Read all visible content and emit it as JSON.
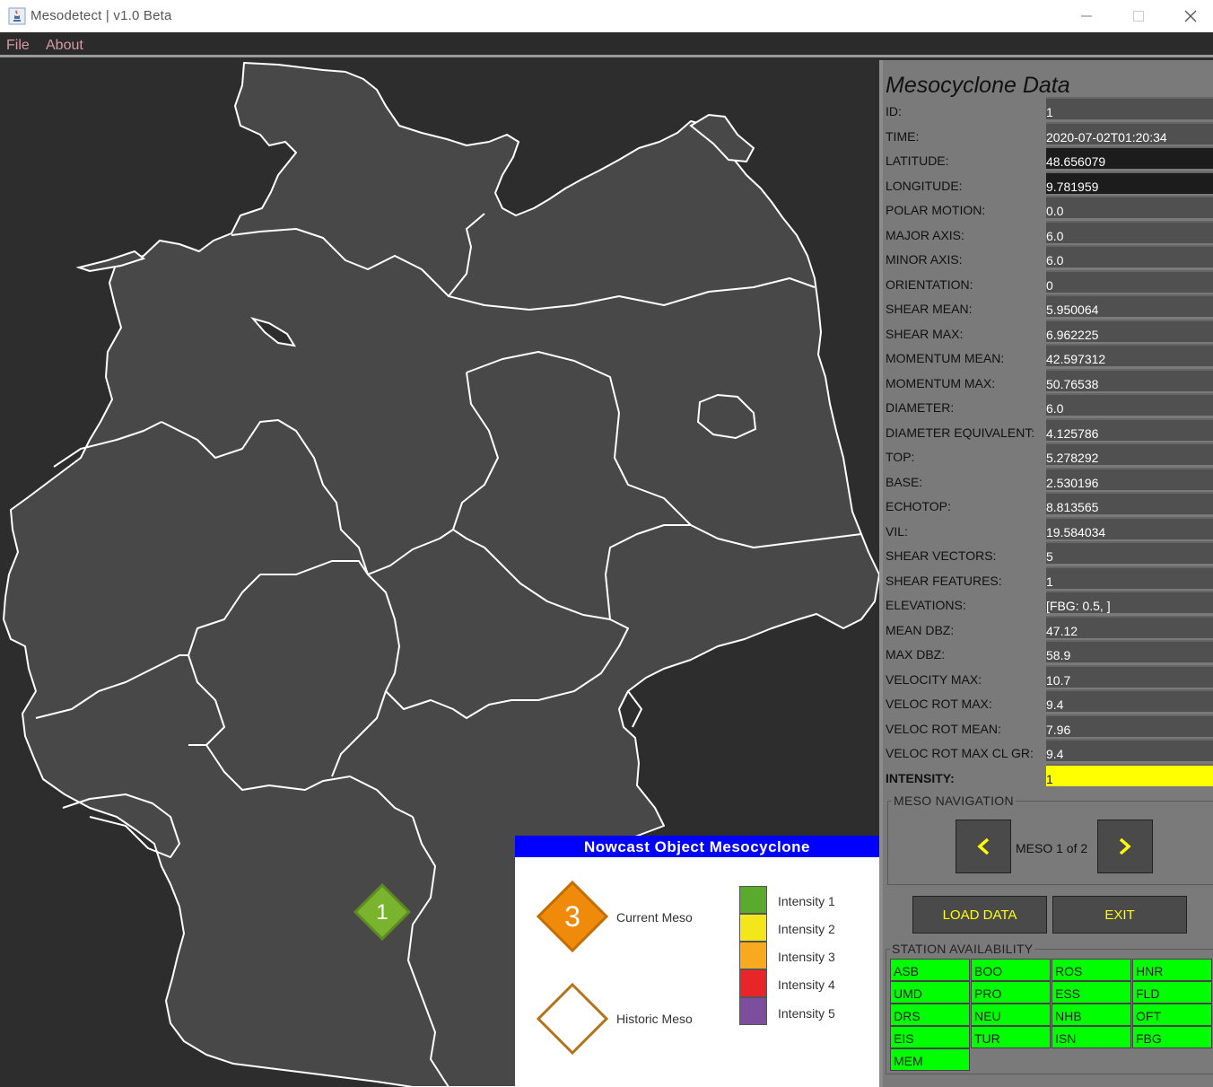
{
  "window": {
    "title": "Mesodetect  |  v1.0 Beta"
  },
  "menu": [
    "File",
    "About"
  ],
  "legend": {
    "title": "Nowcast Object Mesocyclone",
    "current_number": "3",
    "current_label": "Current Meso",
    "historic_label": "Historic Meso",
    "intensities": [
      {
        "label": "Intensity 1",
        "color": "#5aaa2e"
      },
      {
        "label": "Intensity 2",
        "color": "#f3e61a"
      },
      {
        "label": "Intensity 3",
        "color": "#f8a91d"
      },
      {
        "label": "Intensity 4",
        "color": "#e8262a"
      },
      {
        "label": "Intensity 5",
        "color": "#7d4e9e"
      }
    ]
  },
  "map": {
    "marker_label": "1",
    "marker_color": "#7ab32e"
  },
  "data_panel": {
    "title": "Mesocyclone Data",
    "rows": [
      {
        "label": "ID:",
        "value": "1"
      },
      {
        "label": "TIME:",
        "value": "2020-07-02T01:20:34"
      },
      {
        "label": "LATITUDE:",
        "value": "48.656079"
      },
      {
        "label": "LONGITUDE:",
        "value": "9.781959"
      },
      {
        "label": "POLAR MOTION:",
        "value": "0.0"
      },
      {
        "label": "MAJOR AXIS:",
        "value": "6.0"
      },
      {
        "label": "MINOR AXIS:",
        "value": "6.0"
      },
      {
        "label": "ORIENTATION:",
        "value": "0"
      },
      {
        "label": "SHEAR MEAN:",
        "value": "5.950064"
      },
      {
        "label": "SHEAR MAX:",
        "value": "6.962225"
      },
      {
        "label": "MOMENTUM MEAN:",
        "value": "42.597312"
      },
      {
        "label": "MOMENTUM MAX:",
        "value": "50.76538"
      },
      {
        "label": "DIAMETER:",
        "value": "6.0"
      },
      {
        "label": "DIAMETER EQUIVALENT:",
        "value": "4.125786"
      },
      {
        "label": "TOP:",
        "value": "5.278292"
      },
      {
        "label": "BASE:",
        "value": "2.530196"
      },
      {
        "label": "ECHOTOP:",
        "value": "8.813565"
      },
      {
        "label": "VIL:",
        "value": "19.584034"
      },
      {
        "label": "SHEAR VECTORS:",
        "value": "5"
      },
      {
        "label": "SHEAR FEATURES:",
        "value": "1"
      },
      {
        "label": "ELEVATIONS:",
        "value": "[FBG: 0.5, ]"
      },
      {
        "label": "MEAN DBZ:",
        "value": "47.12"
      },
      {
        "label": "MAX DBZ:",
        "value": "58.9"
      },
      {
        "label": "VELOCITY MAX:",
        "value": "10.7"
      },
      {
        "label": "VELOC ROT MAX:",
        "value": "9.4"
      },
      {
        "label": "VELOC ROT MEAN:",
        "value": "7.96"
      },
      {
        "label": "VELOC ROT MAX CL GR:",
        "value": "9.4"
      },
      {
        "label": "INTENSITY:",
        "value": "1"
      }
    ]
  },
  "navigation": {
    "title": "MESO NAVIGATION",
    "count_text": "MESO 1 of 2"
  },
  "actions": {
    "load_label": "LOAD DATA",
    "exit_label": "EXIT"
  },
  "stations": {
    "title": "STATION AVAILABILITY",
    "items": [
      "ASB",
      "BOO",
      "ROS",
      "HNR",
      "UMD",
      "PRO",
      "ESS",
      "FLD",
      "DRS",
      "NEU",
      "NHB",
      "OFT",
      "EIS",
      "TUR",
      "ISN",
      "FBG",
      "MEM"
    ],
    "available_color": "#00ff00"
  }
}
